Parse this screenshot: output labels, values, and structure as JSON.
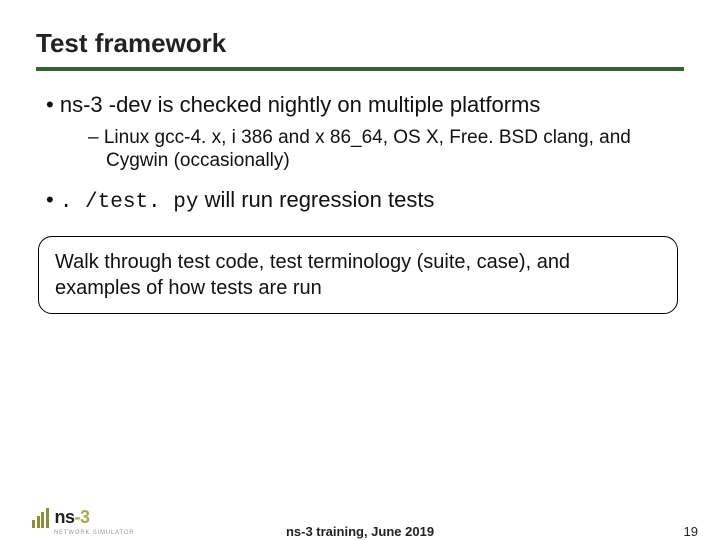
{
  "title": "Test framework",
  "bullets": {
    "b1": "ns-3 -dev is checked nightly on multiple platforms",
    "b1_sub": "Linux gcc-4. x, i 386 and x 86_64, OS X, Free. BSD clang, and Cygwin (occasionally)",
    "b2_code": ". /test. py",
    "b2_rest": " will run regression tests"
  },
  "callout": "Walk through test code, test terminology (suite, case), and examples of how tests are run",
  "footer": {
    "center": "ns-3 training, June 2019",
    "page": "19"
  },
  "logo": {
    "sub": "NETWORK SIMULATOR"
  }
}
